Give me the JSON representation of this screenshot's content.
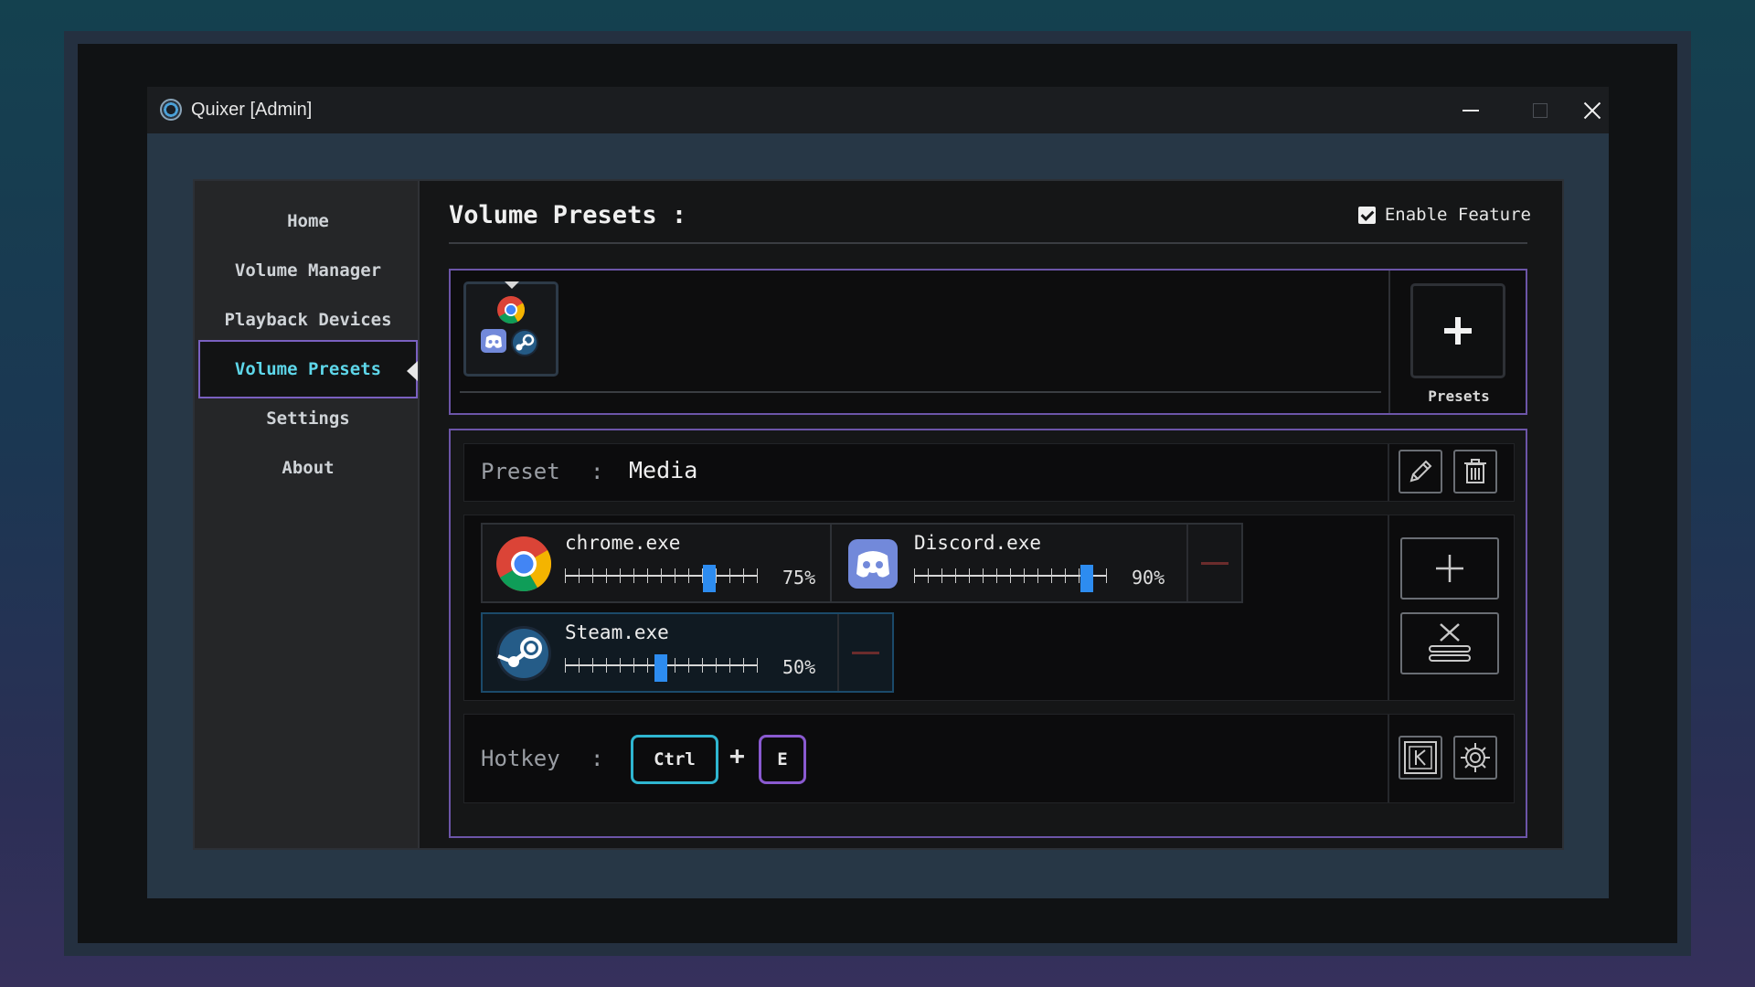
{
  "window": {
    "title": "Quixer [Admin]",
    "controls": [
      "minimize",
      "maximize",
      "close"
    ]
  },
  "sidebar": {
    "items": [
      {
        "label": "Home",
        "active": false
      },
      {
        "label": "Volume Manager",
        "active": false
      },
      {
        "label": "Playback Devices",
        "active": false
      },
      {
        "label": "Volume Presets",
        "active": true
      },
      {
        "label": "Settings",
        "active": false
      },
      {
        "label": "About",
        "active": false
      }
    ]
  },
  "header": {
    "title": "Volume Presets :",
    "enable_label": "Enable Feature",
    "enable_checked": true
  },
  "presets_strip": {
    "tiles": [
      {
        "apps": [
          "chrome-icon",
          "discord-icon",
          "steam-icon"
        ],
        "selected": true
      }
    ],
    "add_label": "Presets"
  },
  "editor": {
    "preset_label": "Preset",
    "separator": ":",
    "preset_name": "Media",
    "apps": [
      {
        "name": "chrome.exe",
        "icon": "chrome-icon",
        "volume": 75,
        "volume_text": "75%"
      },
      {
        "name": "Discord.exe",
        "icon": "discord-icon",
        "volume": 90,
        "volume_text": "90%"
      },
      {
        "name": "Steam.exe",
        "icon": "steam-icon",
        "volume": 50,
        "volume_text": "50%"
      }
    ],
    "hotkey_label": "Hotkey",
    "hotkey_keys": [
      "Ctrl",
      "E"
    ],
    "hotkey_plus": "+",
    "colors": {
      "accent_purple": "#6c55a8",
      "accent_cyan": "#5ed7ea",
      "slider_thumb": "#2d8cf0",
      "mute_red": "#6b2c2c"
    }
  }
}
